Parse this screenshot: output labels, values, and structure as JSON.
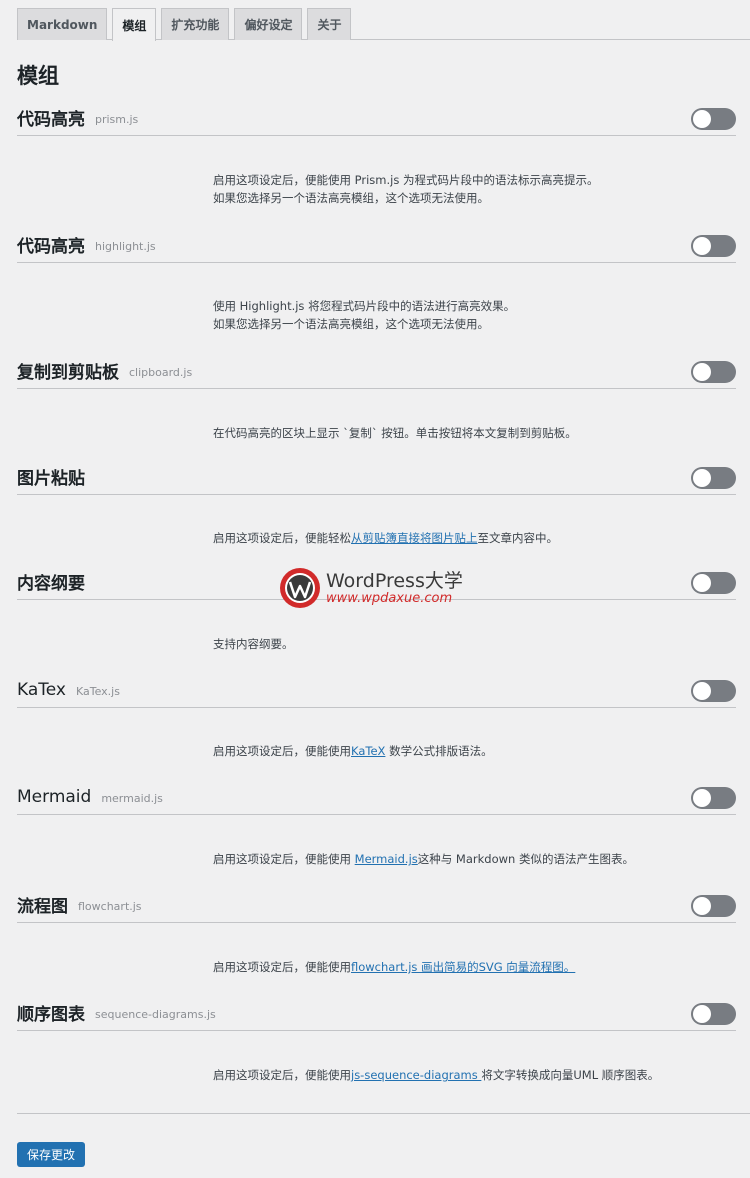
{
  "tabs": [
    {
      "label": "Markdown",
      "active": false
    },
    {
      "label": "模组",
      "active": true
    },
    {
      "label": "扩充功能",
      "active": false
    },
    {
      "label": "偏好设定",
      "active": false
    },
    {
      "label": "关于",
      "active": false
    }
  ],
  "page_title": "模组",
  "sections": [
    {
      "title": "代码高亮",
      "subtitle": "prism.js",
      "enabled": false,
      "desc": [
        "启用这项设定后，便能使用 Prism.js 为程式码片段中的语法标示高亮提示。",
        "如果您选择另一个语法高亮模组，这个选项无法使用。"
      ]
    },
    {
      "title": "代码高亮",
      "subtitle": "highlight.js",
      "enabled": false,
      "desc": [
        "使用 Highlight.js 将您程式码片段中的语法进行高亮效果。",
        "如果您选择另一个语法高亮模组，这个选项无法使用。"
      ]
    },
    {
      "title": "复制到剪贴板",
      "subtitle": "clipboard.js",
      "enabled": false,
      "desc": [
        "在代码高亮的区块上显示 `复制` 按钮。单击按钮将本文复制到剪贴板。"
      ]
    },
    {
      "title": "图片粘贴",
      "subtitle": "",
      "enabled": false,
      "desc_pre": "启用这项设定后，便能轻松",
      "desc_link": "从剪贴簿直接将图片贴上",
      "desc_post": "至文章内容中。"
    },
    {
      "title": "内容纲要",
      "subtitle": "",
      "enabled": false,
      "desc": [
        "支持内容纲要。"
      ]
    },
    {
      "title": "KaTex",
      "subtitle": "KaTex.js",
      "enabled": false,
      "desc_pre": "启用这项设定后，便能使用",
      "desc_link": "KaTeX",
      "desc_post": " 数学公式排版语法。"
    },
    {
      "title": "Mermaid",
      "subtitle": "mermaid.js",
      "enabled": false,
      "desc_pre": "启用这项设定后，便能使用 ",
      "desc_link": "Mermaid.js",
      "desc_post": "这种与 Markdown 类似的语法产生图表。"
    },
    {
      "title": "流程图",
      "subtitle": "flowchart.js",
      "enabled": false,
      "desc_pre": "启用这项设定后，便能使用",
      "desc_link": "flowchart.js 画出简易的SVG 向量流程图。",
      "desc_post": ""
    },
    {
      "title": "顺序图表",
      "subtitle": "sequence-diagrams.js",
      "enabled": false,
      "desc_pre": "启用这项设定后，便能使用",
      "desc_link": "js-sequence-diagrams ",
      "desc_post": "将文字转换成向量UML 顺序图表。"
    }
  ],
  "save_label": "保存更改",
  "watermark": {
    "name": "WordPress大学",
    "url": "www.wpdaxue.com"
  },
  "colors": {
    "accent": "#2271b1",
    "toggle_off": "#787c82",
    "watermark_red": "#d12a2a"
  }
}
